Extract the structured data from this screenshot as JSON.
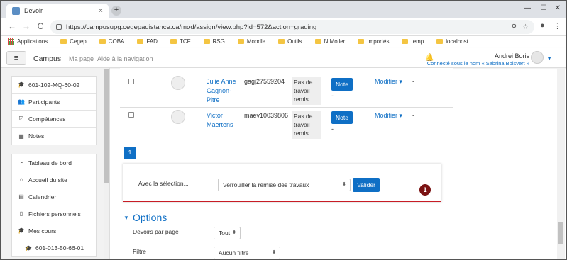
{
  "browser": {
    "tab_title": "Devoir",
    "tab_close": "×",
    "new_tab": "+",
    "url": "https://campusupg.cegepadistance.ca/mod/assign/view.php?id=572&action=grading",
    "back": "←",
    "forward": "→",
    "reload": "C",
    "zoom_icon": "⚲",
    "star_icon": "☆",
    "account_icon": "●",
    "menu_icon": "⋮",
    "win_min": "—",
    "win_max": "☐",
    "win_close": "✕",
    "bookmarks": [
      {
        "label": "Applications",
        "type": "apps"
      },
      {
        "label": "Cegep",
        "type": "folder"
      },
      {
        "label": "COBA",
        "type": "folder"
      },
      {
        "label": "FAD",
        "type": "folder"
      },
      {
        "label": "TCF",
        "type": "folder"
      },
      {
        "label": "RSG",
        "type": "folder"
      },
      {
        "label": "Moodle",
        "type": "folder"
      },
      {
        "label": "Outils",
        "type": "folder"
      },
      {
        "label": "N.Moller",
        "type": "folder"
      },
      {
        "label": "Importés",
        "type": "folder"
      },
      {
        "label": "temp",
        "type": "folder"
      },
      {
        "label": "localhost",
        "type": "folder"
      }
    ]
  },
  "navbar": {
    "menu_icon": "≡",
    "site_name": "Campus",
    "links": [
      "Ma page",
      "Aide à la navigation"
    ],
    "bell_icon": "🔔",
    "user_name": "Andrei Boris",
    "logged_as": "Connecté sous le nom « Sabrina Boisvert »",
    "caret": "▼"
  },
  "drawer": {
    "group1": [
      {
        "icon": "🎓",
        "label": "601-102-MQ-60-02"
      },
      {
        "icon": "👥",
        "label": "Participants"
      },
      {
        "icon": "☑",
        "label": "Compétences"
      },
      {
        "icon": "▦",
        "label": "Notes"
      }
    ],
    "group2": [
      {
        "icon": "◔",
        "label": "Tableau de bord"
      },
      {
        "icon": "⌂",
        "label": "Accueil du site"
      },
      {
        "icon": "▤",
        "label": "Calendrier"
      },
      {
        "icon": "▯",
        "label": "Fichiers personnels"
      },
      {
        "icon": "🎓",
        "label": "Mes cours"
      },
      {
        "icon": "🎓",
        "label": "601-013-50-66-01",
        "sub": true
      }
    ]
  },
  "table": {
    "rows": [
      {
        "name": "Julie Anne Gagnon-Pitre",
        "id": "gagj27559204",
        "status": "Pas de travail remis",
        "note": "Note",
        "dash_a": "-",
        "modify": "Modifier ▾",
        "dash_b": "-"
      },
      {
        "name": "Victor Maertens",
        "id": "maev10039806",
        "status": "Pas de travail remis",
        "note": "Note",
        "dash_a": "-",
        "modify": "Modifier ▾",
        "dash_b": "-"
      }
    ],
    "page": "1"
  },
  "selection": {
    "label": "Avec la sélection...",
    "value": "Verrouiller la remise des travaux",
    "arrow": "⬍",
    "submit": "Valider",
    "callout": "1"
  },
  "options": {
    "caret": "▼",
    "title": "Options",
    "per_page_label": "Devoirs par page",
    "per_page_value": "Tout",
    "filter_label": "Filtre",
    "filter_value": "Aucun filtre",
    "arrow": "⬍"
  }
}
